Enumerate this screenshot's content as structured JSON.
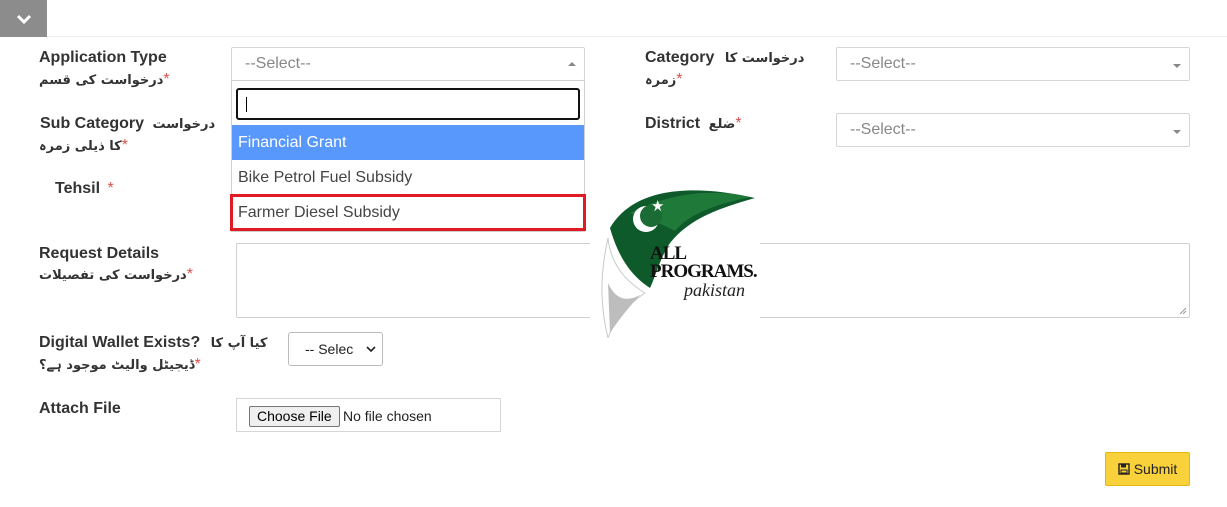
{
  "header": {
    "collapse_icon": "chevron-down-icon"
  },
  "form": {
    "application_type": {
      "label": "Application Type",
      "label_ur": "درخواست کی قسم",
      "required": "*",
      "value": "--Select--"
    },
    "dropdown": {
      "search_value": "",
      "options": [
        "Financial Grant",
        "Bike Petrol Fuel Subsidy",
        "Farmer Diesel Subsidy"
      ],
      "highlighted": "Financial Grant",
      "marked": "Farmer Diesel Subsidy"
    },
    "category": {
      "label": "Category",
      "label_ur_1": "درخواست کا",
      "label_ur_2": "زمرہ",
      "required": "*",
      "value": "--Select--"
    },
    "sub_category": {
      "label": "Sub Category",
      "label_ur_1": "درخواست",
      "label_ur_2": "کا ذیلی زمرہ",
      "required": "*"
    },
    "district": {
      "label": "District",
      "label_ur": "ضلع",
      "required": "*",
      "value": "--Select--"
    },
    "tehsil": {
      "label": "Tehsil",
      "required": "*"
    },
    "request_details": {
      "label": "Request Details",
      "label_ur": "درخواست کی تفصیلات",
      "required": "*",
      "value": ""
    },
    "digital_wallet": {
      "label": "Digital Wallet Exists?",
      "label_ur_1": "کیا آپ کا",
      "label_ur_2": "ڈیجیٹل والیٹ موجود ہے؟",
      "required": "*",
      "value": "-- Selec"
    },
    "attach_file": {
      "label": "Attach File",
      "button": "Choose File",
      "status": "No file chosen"
    },
    "submit": {
      "label": "Submit",
      "icon": "save-icon",
      "color": "#f9d13b"
    }
  },
  "watermark": {
    "line1": "ALL",
    "line2": "PROGRAMS.",
    "line3": "pakistan"
  }
}
